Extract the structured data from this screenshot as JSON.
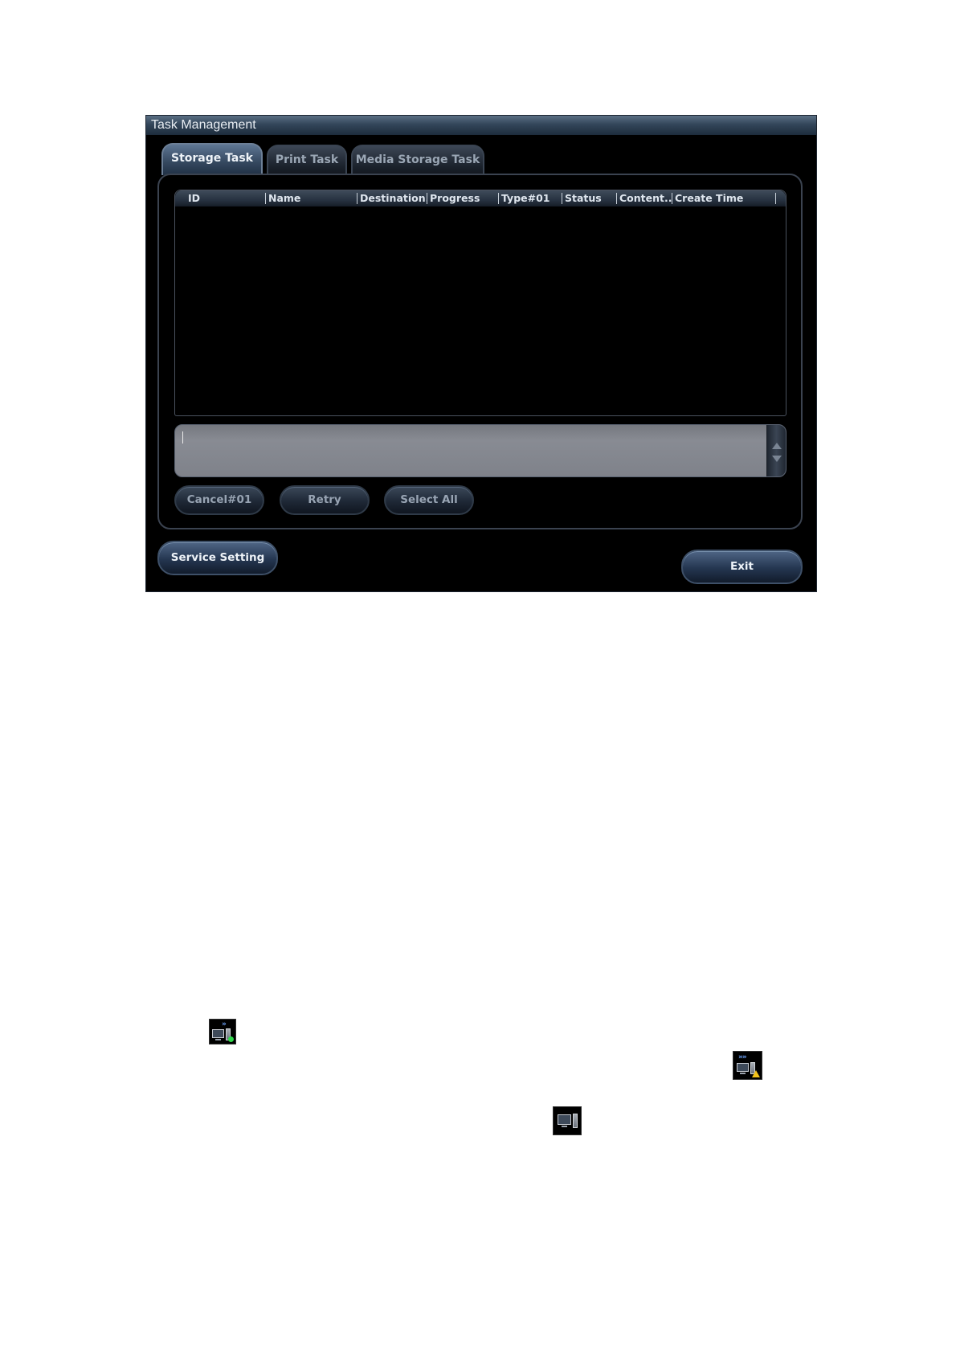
{
  "dialog": {
    "title": "Task Management",
    "tabs": [
      {
        "label": "Storage Task",
        "active": true
      },
      {
        "label": "Print Task",
        "active": false
      },
      {
        "label": "Media Storage Task",
        "active": false
      }
    ],
    "table": {
      "columns": [
        "ID",
        "Name",
        "Destination...",
        "Progress",
        "Type#01",
        "Status",
        "Content...",
        "Create Time"
      ],
      "rows": []
    },
    "log": {
      "text": ""
    },
    "actions": {
      "cancel_label": "Cancel#01",
      "retry_label": "Retry",
      "select_all_label": "Select All"
    },
    "footer": {
      "service_setting_label": "Service Setting",
      "exit_label": "Exit"
    }
  },
  "status_icons": [
    {
      "name": "network-task-sending-icon"
    },
    {
      "name": "network-task-failed-icon"
    },
    {
      "name": "network-idle-icon"
    }
  ],
  "colors": {
    "dialog_bg": "#000000",
    "title_bar": "#33465a",
    "active_tab": "#34475e",
    "log_box": "#7f828a"
  }
}
